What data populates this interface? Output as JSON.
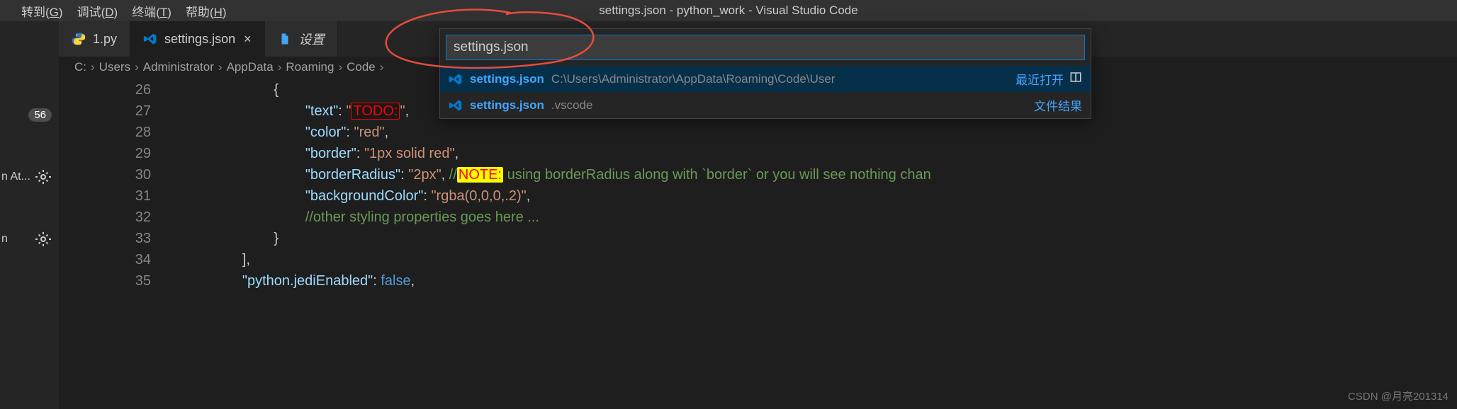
{
  "menubar": {
    "items": [
      {
        "label": "转到",
        "key": "G"
      },
      {
        "label": "调试",
        "key": "D"
      },
      {
        "label": "终端",
        "key": "T"
      },
      {
        "label": "帮助",
        "key": "H"
      }
    ],
    "title": "settings.json - python_work - Visual Studio Code"
  },
  "sidebar": {
    "badge": "56",
    "labels": [
      "",
      "",
      "",
      "n At...",
      "",
      "n",
      ""
    ]
  },
  "tabs": [
    {
      "icon": "python-icon",
      "label": "1.py",
      "active": false,
      "closable": false
    },
    {
      "icon": "vscode-icon",
      "label": "settings.json",
      "active": true,
      "closable": true
    },
    {
      "icon": "file-icon",
      "label": "设置",
      "active": false,
      "italic": true,
      "closable": false
    }
  ],
  "breadcrumb": [
    "C:",
    "Users",
    "Administrator",
    "AppData",
    "Roaming",
    "Code"
  ],
  "code_lines": [
    {
      "n": 26,
      "indent": 24,
      "tokens": [
        {
          "c": "punct",
          "t": "{"
        }
      ]
    },
    {
      "n": 27,
      "indent": 32,
      "tokens": [
        {
          "c": "prop",
          "t": "\"text\""
        },
        {
          "c": "punct",
          "t": ": "
        },
        {
          "c": "str",
          "t": "\""
        },
        {
          "c": "todo",
          "t": "TODO:"
        },
        {
          "c": "str",
          "t": "\""
        },
        {
          "c": "punct",
          "t": ","
        }
      ]
    },
    {
      "n": 28,
      "indent": 32,
      "tokens": [
        {
          "c": "prop",
          "t": "\"color\""
        },
        {
          "c": "punct",
          "t": ": "
        },
        {
          "c": "str",
          "t": "\"red\""
        },
        {
          "c": "punct",
          "t": ","
        }
      ]
    },
    {
      "n": 29,
      "indent": 32,
      "tokens": [
        {
          "c": "prop",
          "t": "\"border\""
        },
        {
          "c": "punct",
          "t": ": "
        },
        {
          "c": "str",
          "t": "\"1px solid red\""
        },
        {
          "c": "punct",
          "t": ","
        }
      ]
    },
    {
      "n": 30,
      "indent": 32,
      "tokens": [
        {
          "c": "prop",
          "t": "\"borderRadius\""
        },
        {
          "c": "punct",
          "t": ": "
        },
        {
          "c": "str",
          "t": "\"2px\""
        },
        {
          "c": "punct",
          "t": ", "
        },
        {
          "c": "comment",
          "t": "//"
        },
        {
          "c": "note",
          "t": "NOTE:"
        },
        {
          "c": "comment",
          "t": " using borderRadius along with `border` or you will see nothing chan"
        }
      ]
    },
    {
      "n": 31,
      "indent": 32,
      "tokens": [
        {
          "c": "prop",
          "t": "\"backgroundColor\""
        },
        {
          "c": "punct",
          "t": ": "
        },
        {
          "c": "str",
          "t": "\"rgba(0,0,0,.2)\""
        },
        {
          "c": "punct",
          "t": ","
        }
      ]
    },
    {
      "n": 32,
      "indent": 32,
      "tokens": [
        {
          "c": "comment",
          "t": "//other styling properties goes here ..."
        }
      ]
    },
    {
      "n": 33,
      "indent": 24,
      "tokens": [
        {
          "c": "punct",
          "t": "}"
        }
      ]
    },
    {
      "n": 34,
      "indent": 16,
      "tokens": [
        {
          "c": "punct",
          "t": "],"
        }
      ]
    },
    {
      "n": 35,
      "indent": 16,
      "tokens": [
        {
          "c": "prop",
          "t": "\"python.jediEnabled\""
        },
        {
          "c": "punct",
          "t": ": "
        },
        {
          "c": "kw",
          "t": "false"
        },
        {
          "c": "punct",
          "t": ","
        }
      ]
    }
  ],
  "quick_open": {
    "input_value": "settings.json",
    "items": [
      {
        "name": "settings.json",
        "path": "C:\\Users\\Administrator\\AppData\\Roaming\\Code\\User",
        "hint": "最近打开",
        "selected": true,
        "split": true
      },
      {
        "name": "settings.json",
        "path": ".vscode",
        "hint": "文件结果",
        "selected": false,
        "split": false
      }
    ]
  },
  "watermark": "CSDN @月亮201314"
}
